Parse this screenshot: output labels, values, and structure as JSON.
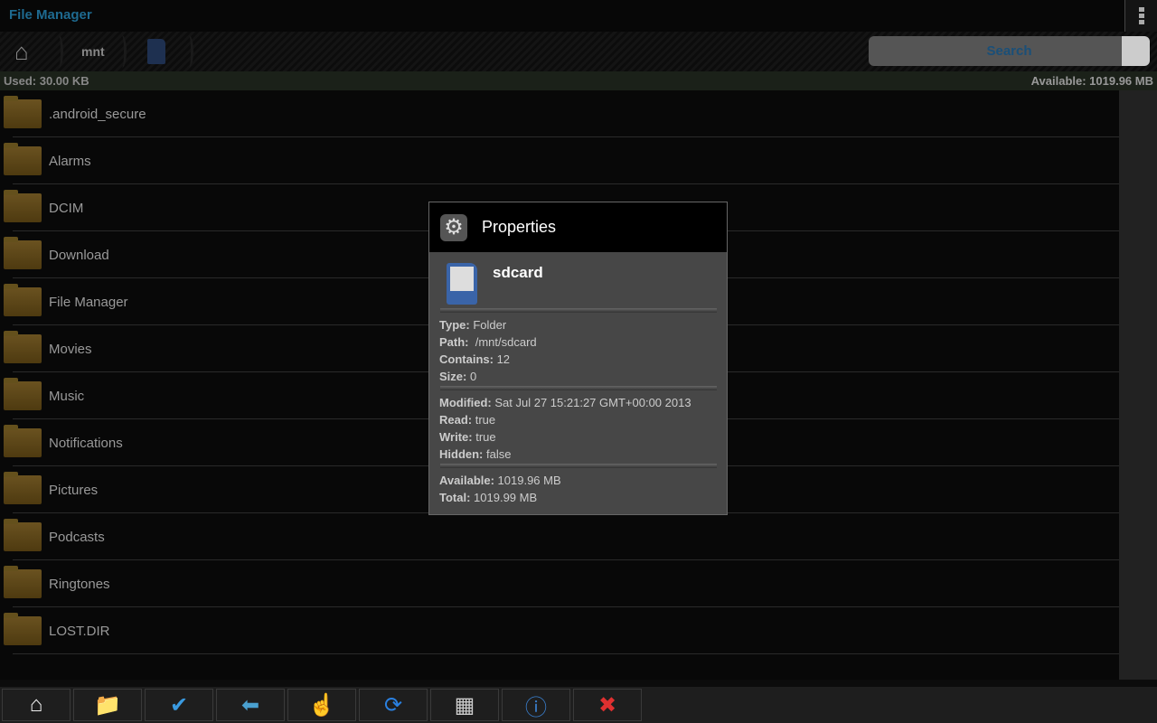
{
  "app": {
    "title": "File Manager"
  },
  "breadcrumb": [
    {
      "icon": "home-icon"
    },
    {
      "label": "mnt"
    },
    {
      "icon": "sdcard-icon"
    }
  ],
  "search": {
    "label": "Search"
  },
  "storage": {
    "used": "Used: 30.00 KB",
    "available": "Available: 1019.96 MB"
  },
  "folders": [
    ".android_secure",
    "Alarms",
    "DCIM",
    "Download",
    "File Manager",
    "Movies",
    "Music",
    "Notifications",
    "Pictures",
    "Podcasts",
    "Ringtones",
    "LOST.DIR"
  ],
  "toolbar": [
    "home-icon",
    "new-folder-icon",
    "multi-select-icon",
    "back-arrow-icon",
    "touch-hand-icon",
    "refresh-icon",
    "grid-view-icon",
    "info-icon",
    "close-icon"
  ],
  "dialog": {
    "title": "Properties",
    "name": "sdcard",
    "props": [
      {
        "k": "Type:",
        "v": " Folder"
      },
      {
        "k": "Path:",
        "v": "  /mnt/sdcard"
      },
      {
        "k": "Contains:",
        "v": " 12"
      },
      {
        "k": "Size:",
        "v": " 0"
      },
      {
        "k": "Modified:",
        "v": " Sat Jul 27 15:21:27 GMT+00:00 2013"
      },
      {
        "k": "Read:",
        "v": " true"
      },
      {
        "k": "Write:",
        "v": " true"
      },
      {
        "k": "Hidden:",
        "v": " false"
      },
      {
        "k": "Available:",
        "v": " 1019.96 MB"
      },
      {
        "k": "Total:",
        "v": " 1019.99 MB"
      }
    ]
  },
  "colors": {
    "accent": "#33b5e5"
  }
}
